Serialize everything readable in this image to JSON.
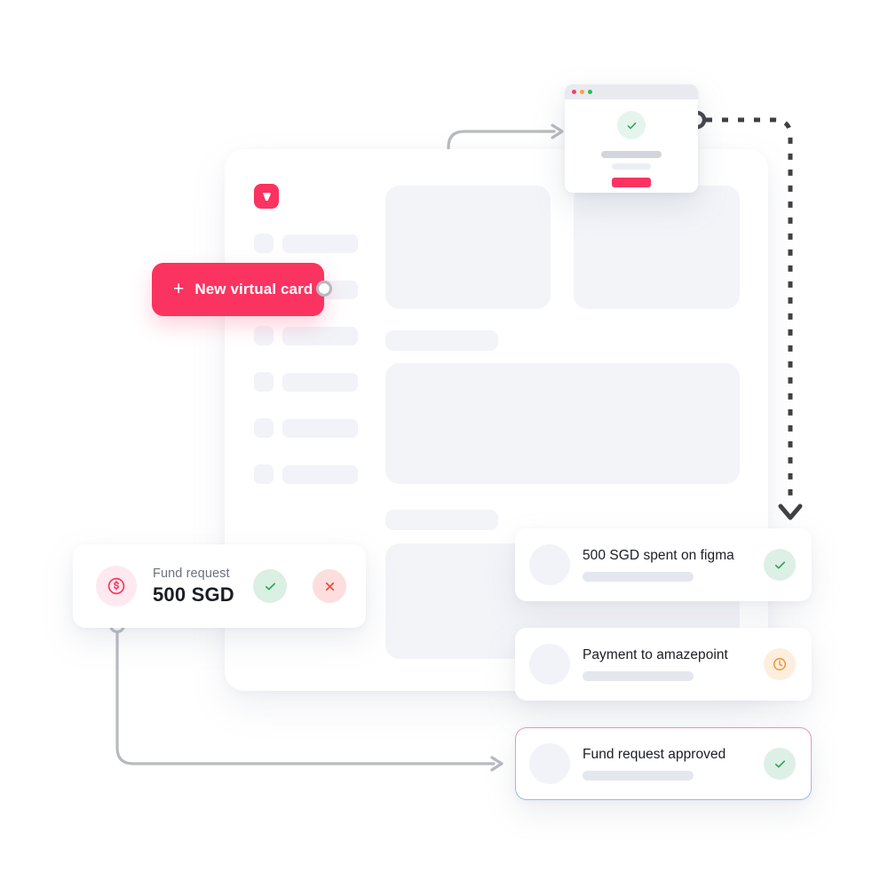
{
  "brand": {
    "logo_icon": "v-logo-icon",
    "accent_color": "#fb3361"
  },
  "cta": {
    "plus_icon": "plus-icon",
    "label": "New virtual card"
  },
  "modal": {
    "window_controls": [
      {
        "name": "close-dot",
        "color": "#f0416c"
      },
      {
        "name": "minimize-dot",
        "color": "#f9a33a"
      },
      {
        "name": "maximize-dot",
        "color": "#2dbb55"
      }
    ],
    "status_icon": "check-icon",
    "confirm_button_color": "#fb3361"
  },
  "fund_request": {
    "coin_icon": "dollar-coin-icon",
    "label": "Fund request",
    "amount": "500 SGD",
    "approve_icon": "check-icon",
    "reject_icon": "close-x-icon"
  },
  "notifications": [
    {
      "avatar": "avatar-placeholder",
      "title": "500 SGD spent on figma",
      "status": "approved",
      "status_icon": "check-icon",
      "status_color": "#2e9e5b",
      "highlighted": false
    },
    {
      "avatar": "avatar-placeholder",
      "title": "Payment to amazepoint",
      "status": "pending",
      "status_icon": "clock-icon",
      "status_color": "#f08a28",
      "highlighted": false
    },
    {
      "avatar": "avatar-placeholder",
      "title": "Fund request approved",
      "status": "approved",
      "status_icon": "check-icon",
      "status_color": "#2e9e5b",
      "highlighted": true
    }
  ],
  "connectors": {
    "solid_color": "#b7bac0",
    "dashed_color": "#3f4045"
  }
}
